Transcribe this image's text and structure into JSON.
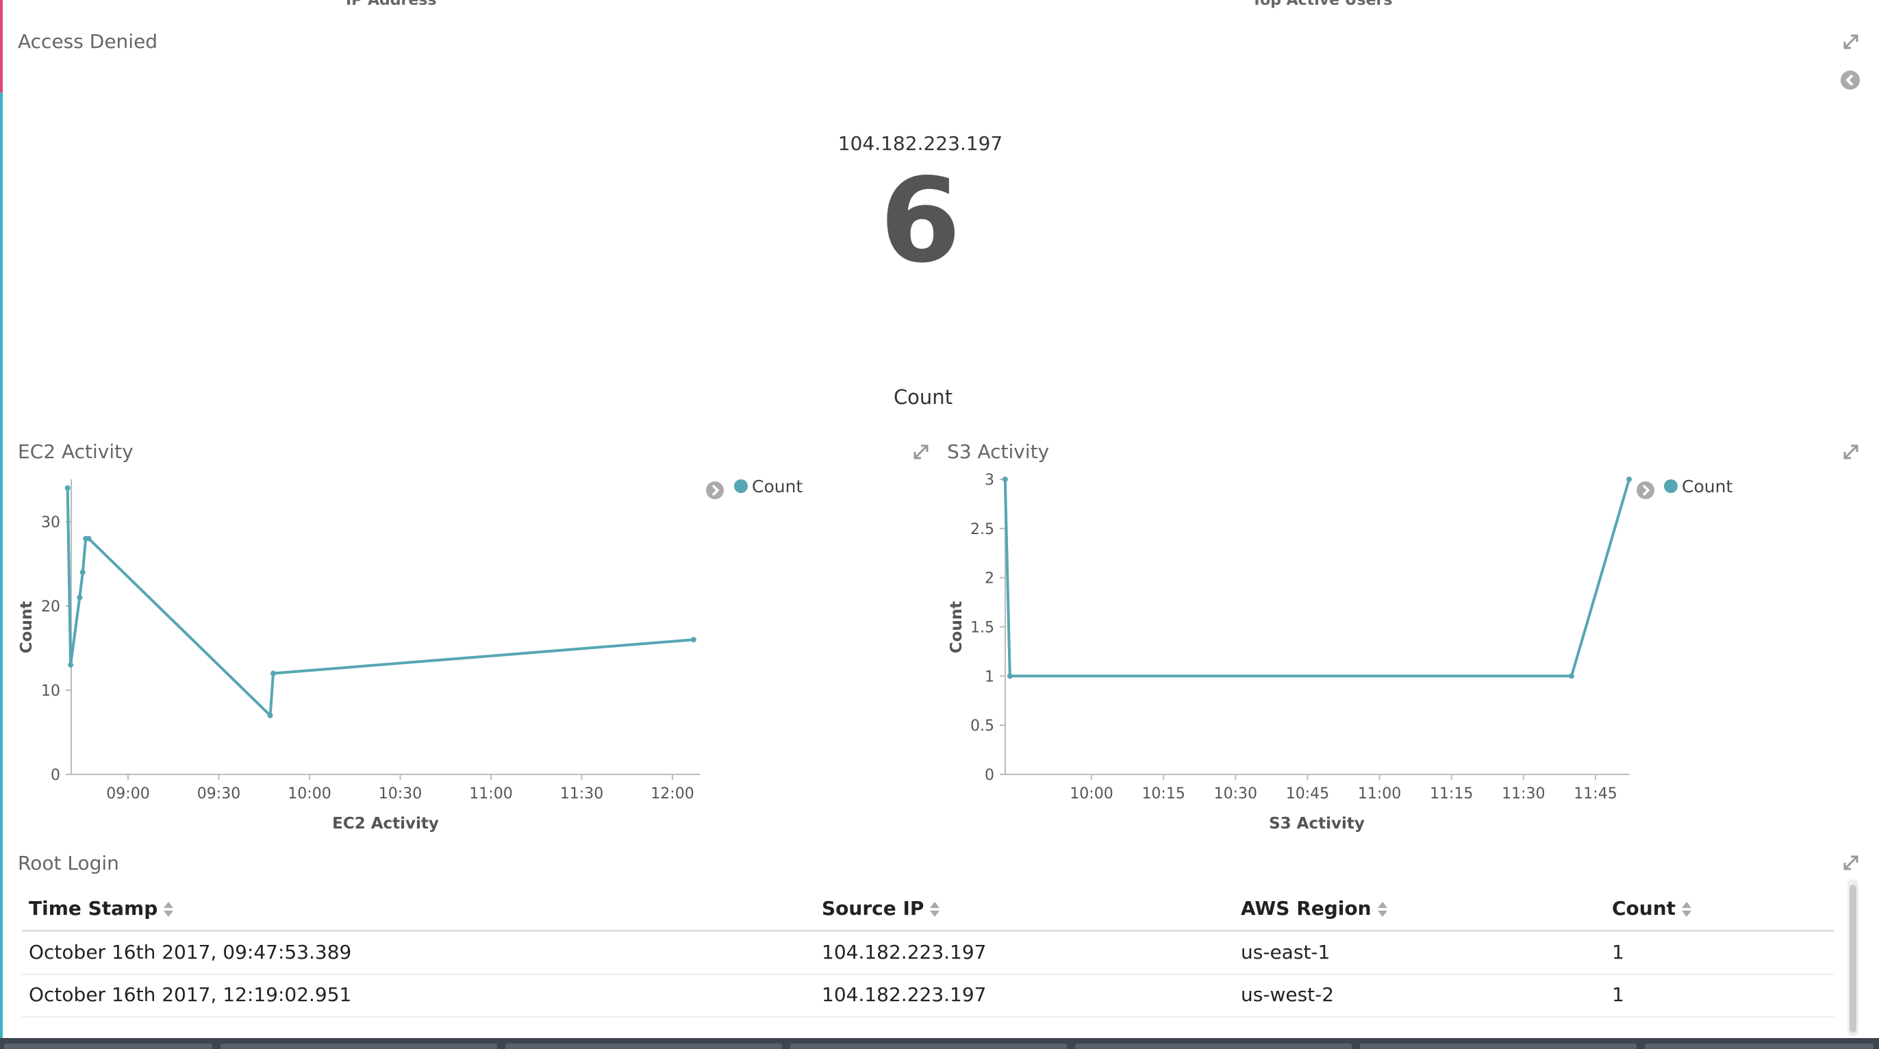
{
  "top_tabs": [
    "IP Address",
    "Top Active Users"
  ],
  "access_denied": {
    "title": "Access Denied",
    "label": "104.182.223.197",
    "value": "6",
    "metric": "Count"
  },
  "ec2": {
    "title": "EC2 Activity",
    "legend": "Count",
    "ylabel": "Count",
    "xlabel": "EC2 Activity",
    "yticks": [
      "0",
      "10",
      "20",
      "30"
    ],
    "xticks": [
      "09:00",
      "09:30",
      "10:00",
      "10:30",
      "11:00",
      "11:30",
      "12:00"
    ]
  },
  "s3": {
    "title": "S3 Activity",
    "legend": "Count",
    "ylabel": "Count",
    "xlabel": "S3 Activity",
    "yticks": [
      "0",
      "0.5",
      "1",
      "1.5",
      "2",
      "2.5",
      "3"
    ],
    "xticks": [
      "10:00",
      "10:15",
      "10:30",
      "10:45",
      "11:00",
      "11:15",
      "11:30",
      "11:45"
    ]
  },
  "root_login": {
    "title": "Root Login",
    "columns": [
      "Time Stamp",
      "Source IP",
      "AWS Region",
      "Count"
    ],
    "rows": [
      [
        "October 16th 2017, 09:47:53.389",
        "104.182.223.197",
        "us-east-1",
        "1"
      ],
      [
        "October 16th 2017, 12:19:02.951",
        "104.182.223.197",
        "us-west-2",
        "1"
      ]
    ]
  },
  "colors": {
    "series": "#57a6b4",
    "axis": "#bbbbbb",
    "accent_pink": "#e0457b",
    "accent_teal": "#3cb3c4"
  },
  "chart_data": [
    {
      "type": "line",
      "title": "",
      "xlabel": "EC2 Activity",
      "ylabel": "Count",
      "x_axis": "time",
      "ylim": [
        0,
        35
      ],
      "series": [
        {
          "name": "Count",
          "x": [
            "08:40",
            "08:41",
            "08:44",
            "08:45",
            "08:46",
            "08:47",
            "09:47",
            "09:48",
            "12:07"
          ],
          "y": [
            34,
            13,
            21,
            24,
            28,
            28,
            7,
            12,
            16
          ]
        }
      ]
    },
    {
      "type": "line",
      "title": "",
      "xlabel": "S3 Activity",
      "ylabel": "Count",
      "x_axis": "time",
      "ylim": [
        0,
        3
      ],
      "series": [
        {
          "name": "Count",
          "x": [
            "09:42",
            "09:43",
            "11:40",
            "11:52"
          ],
          "y": [
            3,
            1,
            1,
            3
          ]
        }
      ]
    }
  ]
}
